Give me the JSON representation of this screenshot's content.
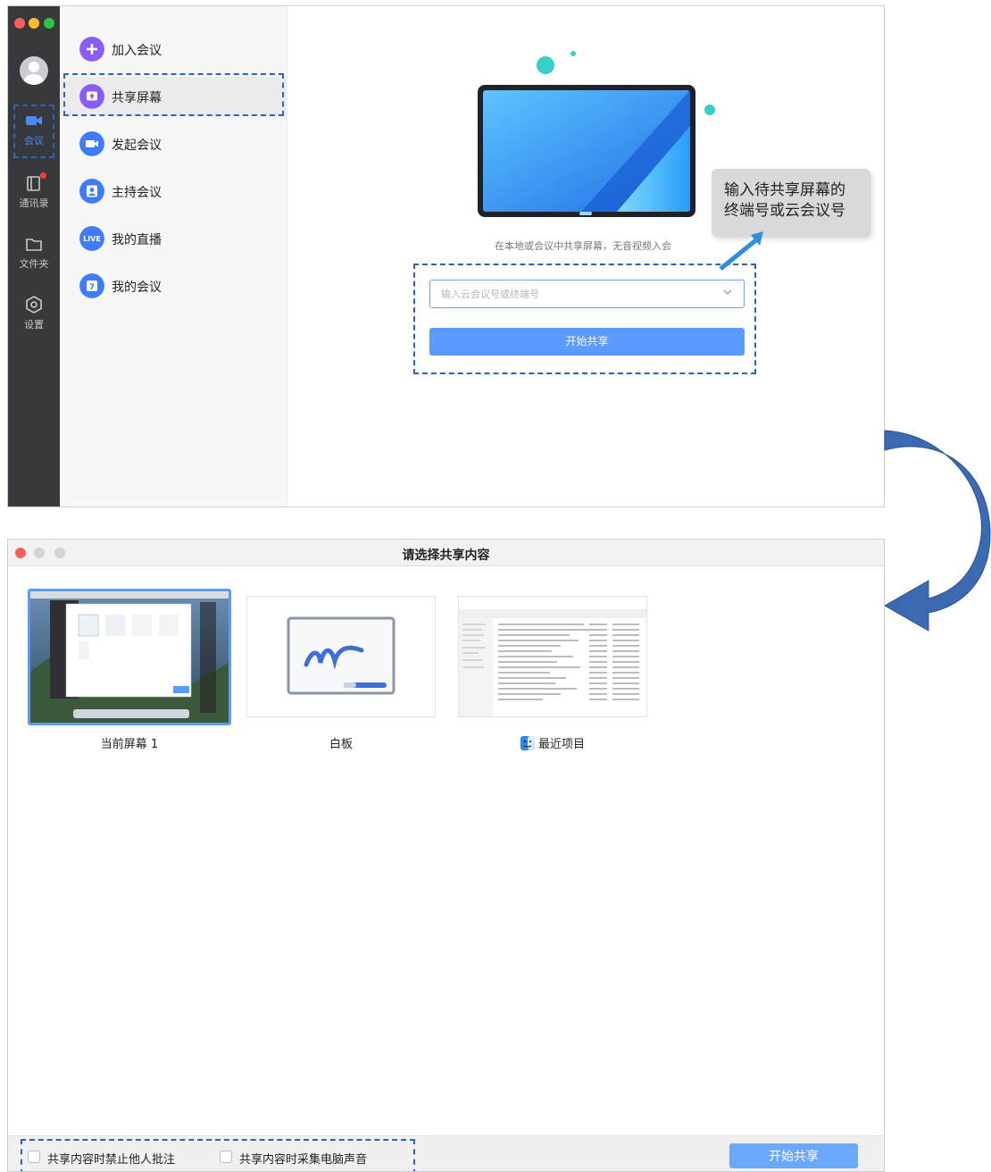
{
  "top_window": {
    "rail": {
      "items": [
        {
          "label": "会议",
          "icon": "video-camera-icon"
        },
        {
          "label": "通讯录",
          "icon": "contacts-icon"
        },
        {
          "label": "文件夹",
          "icon": "folder-icon"
        },
        {
          "label": "设置",
          "icon": "settings-icon"
        }
      ]
    },
    "menu": {
      "items": [
        {
          "label": "加入会议",
          "icon": "plus-circle-icon",
          "color": "#8a5cf6"
        },
        {
          "label": "共享屏幕",
          "icon": "share-screen-icon",
          "color": "#8a5cf6"
        },
        {
          "label": "发起会议",
          "icon": "video-camera-icon",
          "color": "#3d7bff"
        },
        {
          "label": "主持会议",
          "icon": "host-icon",
          "color": "#3d7bff"
        },
        {
          "label": "我的直播",
          "icon": "live-icon",
          "color": "#3d7bff"
        },
        {
          "label": "我的会议",
          "icon": "calendar-icon",
          "color": "#3d7bff"
        }
      ]
    },
    "main": {
      "description": "在本地或会议中共享屏幕，无音视频入会",
      "input_placeholder": "输入云会议号或终端号",
      "start_button": "开始共享",
      "callout_line1": "输入待共享屏幕的",
      "callout_line2": "终端号或云会议号"
    }
  },
  "bottom_window": {
    "title": "请选择共享内容",
    "cards": [
      {
        "label": "当前屏幕 1",
        "selected": true
      },
      {
        "label": "白板",
        "selected": false
      },
      {
        "label": "最近项目",
        "selected": false,
        "icon": "finder-icon"
      }
    ],
    "footer": {
      "checkbox1": "共享内容时禁止他人批注",
      "checkbox2": "共享内容时采集电脑声音",
      "start_button": "开始共享"
    }
  },
  "colors": {
    "accent": "#5b9bff",
    "annotation_dash": "#2f63b8",
    "rail_bg": "#37393d"
  }
}
